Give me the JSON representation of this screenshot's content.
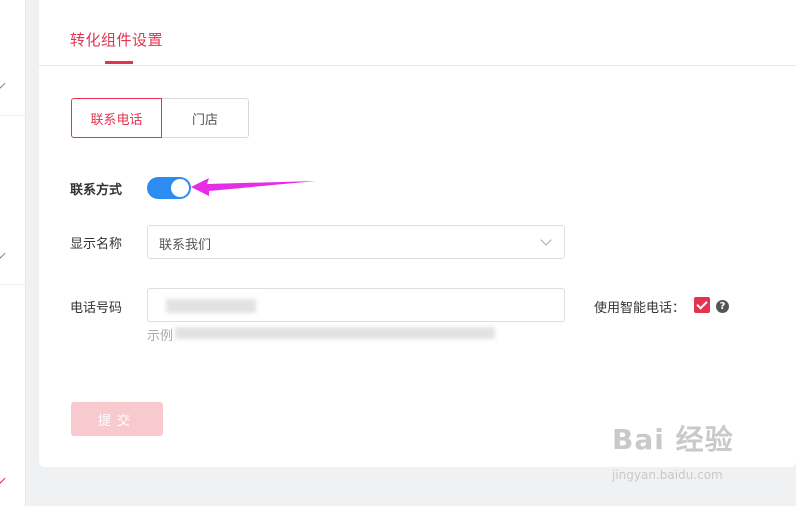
{
  "page": {
    "title": "转化组件设置"
  },
  "segments": {
    "active": "联系电话",
    "inactive": "门店"
  },
  "form": {
    "contact_method_label": "联系方式",
    "contact_method_enabled": true,
    "display_name_label": "显示名称",
    "display_name_value": "联系我们",
    "phone_label": "电话号码",
    "phone_hint": "示例",
    "smart_phone_label": "使用智能电话：",
    "smart_phone_checked": true,
    "help_glyph": "?"
  },
  "submit_label": "提交",
  "watermark": {
    "brand": "Bai 经验",
    "url": "jingyan.baidu.com"
  },
  "colors": {
    "accent": "#e4334f",
    "switch_on": "#2d8cf0",
    "arrow": "#e62ce6"
  }
}
